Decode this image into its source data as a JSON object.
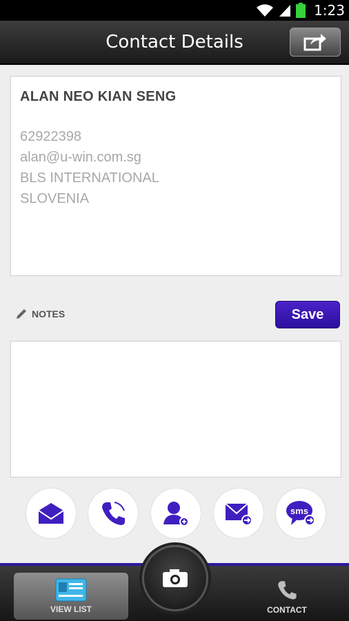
{
  "status_bar": {
    "time": "1:23"
  },
  "header": {
    "title": "Contact Details",
    "share_icon": "share-icon"
  },
  "contact": {
    "name": "ALAN NEO KIAN SENG",
    "phone": "62922398",
    "email": "alan@u-win.com.sg",
    "company": "BLS INTERNATIONAL",
    "country": "SLOVENIA"
  },
  "notes": {
    "label": "NOTES",
    "save_label": "Save",
    "value": ""
  },
  "actions": [
    {
      "icon": "email-icon"
    },
    {
      "icon": "phone-icon"
    },
    {
      "icon": "add-contact-icon"
    },
    {
      "icon": "forward-email-icon"
    },
    {
      "icon": "sms-icon",
      "text": "sms"
    }
  ],
  "bottom_nav": {
    "view_list_label": "VIEW LIST",
    "contact_label": "CONTACT",
    "camera_icon": "camera-icon"
  },
  "colors": {
    "accent": "#2d0f9e",
    "icon": "#3f1fc0"
  }
}
